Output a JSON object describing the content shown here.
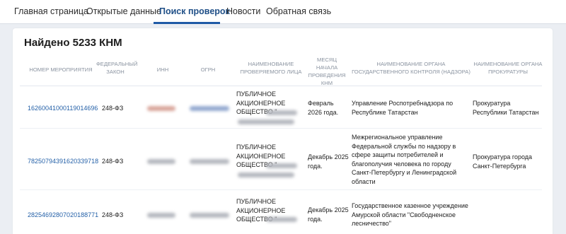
{
  "nav": {
    "items": [
      "Главная страница",
      "Открытые данные",
      "Поиск проверок",
      "Новости",
      "Обратная связь"
    ],
    "active_index": 2
  },
  "results": {
    "title": "Найдено 5233 КНМ"
  },
  "table": {
    "columns": [
      "НОМЕР МЕРОПРИЯТИЯ",
      "ФЕДЕРАЛЬНЫЙ ЗАКОН",
      "ИНН",
      "ОГРН",
      "НАИМЕНОВАНИЕ ПРОВЕРЯЕМОГО ЛИЦА",
      "МЕСЯЦ НАЧАЛА ПРОВЕДЕНИЯ КНМ",
      "НАИМЕНОВАНИЕ ОРГАНА ГОСУДАРСТВЕННОГО КОНТРОЛЯ (НАДЗОРА)",
      "НАИМЕНОВАНИЕ ОРГАНА ПРОКУРАТУРЫ"
    ],
    "rows": [
      {
        "number": "16260041000119014696",
        "law": "248-ФЗ",
        "entity_prefix": "ПУБЛИЧНОЕ АКЦИОНЕРНОЕ ОБЩЕСТВО \"",
        "month": "Февраль 2026 года.",
        "authority": "Управление Роспотребнадзора по Республике Татарстан",
        "prosecutor": "Прокуратура Республики Татарстан"
      },
      {
        "number": "78250794391620339718",
        "law": "248-ФЗ",
        "entity_prefix": "ПУБЛИЧНОЕ АКЦИОНЕРНОЕ ОБЩЕСТВО \"",
        "month": "Декабрь 2025 года.",
        "authority": "Межрегиональное управление Федеральной службы по надзору в сфере защиты потребителей и благополучия человека по городу Санкт-Петербургу и Ленинградской области",
        "prosecutor": "Прокуратура города Санкт-Петербурга"
      },
      {
        "number": "28254692807020188771",
        "law": "248-ФЗ",
        "entity_prefix": "ПУБЛИЧНОЕ АКЦИОНЕРНОЕ ОБЩЕСТВО \"",
        "month": "Декабрь 2025 года.",
        "authority": "Государственное казенное учреждение Амурской области \"Свободненское лесничество\"",
        "prosecutor": ""
      }
    ]
  }
}
